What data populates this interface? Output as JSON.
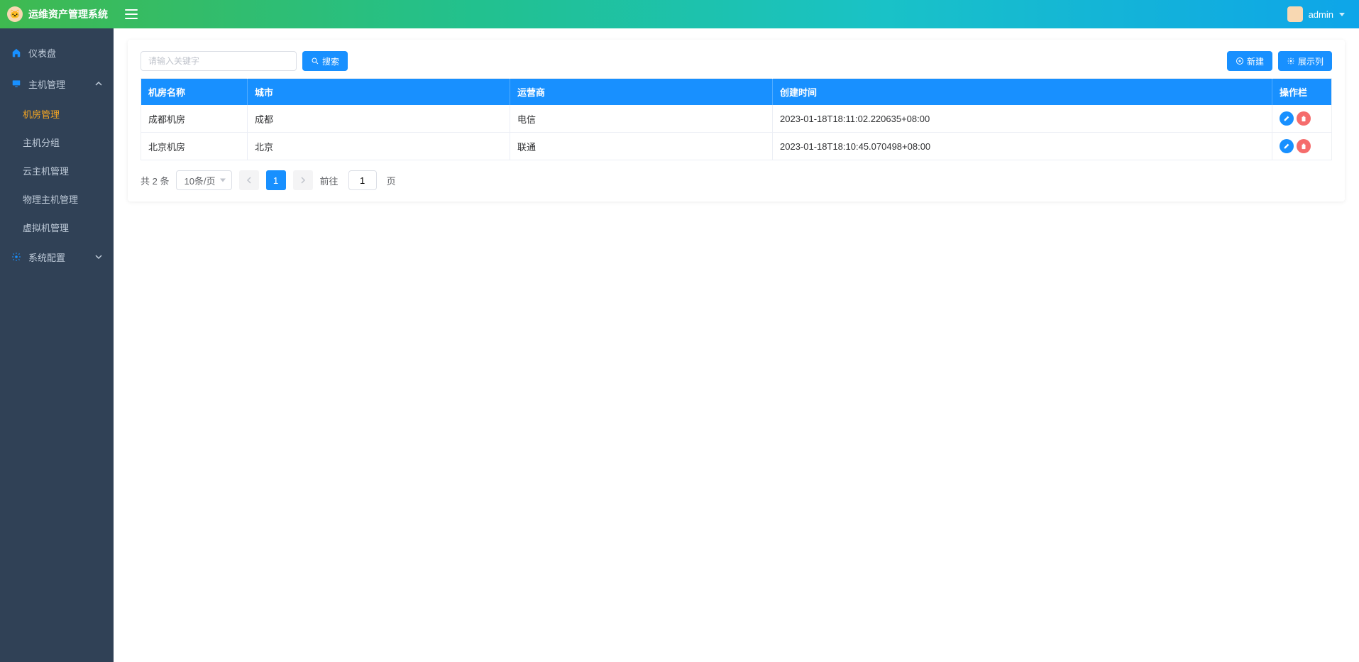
{
  "app_title": "运维资产管理系统",
  "username": "admin",
  "sidebar": {
    "dashboard": "仪表盘",
    "host_mgmt": "主机管理",
    "sub": {
      "room": "机房管理",
      "group": "主机分组",
      "cloud": "云主机管理",
      "physical": "物理主机管理",
      "vm": "虚拟机管理"
    },
    "sysconf": "系统配置"
  },
  "toolbar": {
    "search_placeholder": "请输入关键字",
    "search_btn": "搜索",
    "new_btn": "新建",
    "show_cols_btn": "展示列"
  },
  "table": {
    "headers": {
      "name": "机房名称",
      "city": "城市",
      "isp": "运营商",
      "created": "创建时间",
      "ops": "操作栏"
    },
    "rows": [
      {
        "name": "成都机房",
        "city": "成都",
        "isp": "电信",
        "created": "2023-01-18T18:11:02.220635+08:00"
      },
      {
        "name": "北京机房",
        "city": "北京",
        "isp": "联通",
        "created": "2023-01-18T18:10:45.070498+08:00"
      }
    ]
  },
  "pagination": {
    "total_text": "共 2 条",
    "page_size_label": "10条/页",
    "current_page": "1",
    "goto_prefix": "前往",
    "goto_value": "1",
    "goto_suffix": "页"
  },
  "colors": {
    "primary": "#1890ff",
    "danger": "#f56c6c",
    "sidebar": "#304156",
    "active": "#f5a623"
  }
}
